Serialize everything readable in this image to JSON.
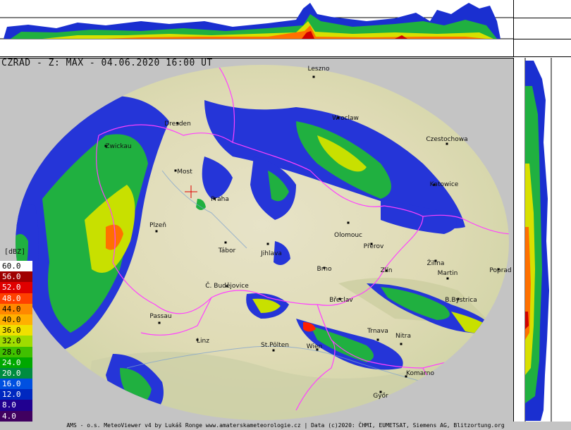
{
  "title": "CZRAD - Z: MAX - 04.06.2020 16:00 UT",
  "legend_unit": "[dBZ]",
  "legend": [
    {
      "value": "60.0",
      "color": "#ffffff",
      "text": "#000"
    },
    {
      "value": "56.0",
      "color": "#a00000",
      "text": "#fff"
    },
    {
      "value": "52.0",
      "color": "#e00000",
      "text": "#fff"
    },
    {
      "value": "48.0",
      "color": "#ff4000",
      "text": "#fff"
    },
    {
      "value": "44.0",
      "color": "#ff8800",
      "text": "#000"
    },
    {
      "value": "40.0",
      "color": "#ffb000",
      "text": "#000"
    },
    {
      "value": "36.0",
      "color": "#f0e000",
      "text": "#000"
    },
    {
      "value": "32.0",
      "color": "#a0dc00",
      "text": "#000"
    },
    {
      "value": "28.0",
      "color": "#40c000",
      "text": "#000"
    },
    {
      "value": "24.0",
      "color": "#00a800",
      "text": "#fff"
    },
    {
      "value": "20.0",
      "color": "#008c40",
      "text": "#fff"
    },
    {
      "value": "16.0",
      "color": "#0050e0",
      "text": "#fff"
    },
    {
      "value": "12.0",
      "color": "#0028c0",
      "text": "#fff"
    },
    {
      "value": "8.0",
      "color": "#200090",
      "text": "#fff"
    },
    {
      "value": "4.0",
      "color": "#400060",
      "text": "#fff"
    }
  ],
  "cities": [
    {
      "name": "Leszno"
    },
    {
      "name": "Wroclaw"
    },
    {
      "name": "Czestochowa"
    },
    {
      "name": "Dresden"
    },
    {
      "name": "Zwickau"
    },
    {
      "name": "Most"
    },
    {
      "name": "Praha"
    },
    {
      "name": "Katowice"
    },
    {
      "name": "Plzeň"
    },
    {
      "name": "Olomouc"
    },
    {
      "name": "Přerov"
    },
    {
      "name": "Tábor"
    },
    {
      "name": "Jihlava"
    },
    {
      "name": "Brno"
    },
    {
      "name": "Zlín"
    },
    {
      "name": "Žilina"
    },
    {
      "name": "Martin"
    },
    {
      "name": "Poprad"
    },
    {
      "name": "Č. Budějovice"
    },
    {
      "name": "Břeclav"
    },
    {
      "name": "B.Bystrica"
    },
    {
      "name": "Passau"
    },
    {
      "name": "Linz"
    },
    {
      "name": "St.Pölten"
    },
    {
      "name": "Wien"
    },
    {
      "name": "Trnava"
    },
    {
      "name": "Nitra"
    },
    {
      "name": "Komarno"
    },
    {
      "name": "Győr"
    }
  ],
  "footer": "AMS - o.s. MeteoViewer v4 by Lukáš Ronge www.amaterskameteorologie.cz | Data (c)2020: ČHMI, EUMETSAT, Siemens AG, Blitzortung.org"
}
